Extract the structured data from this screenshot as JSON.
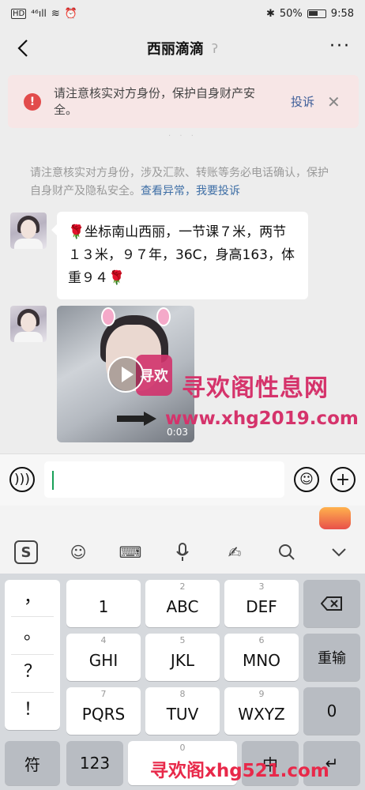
{
  "status_bar": {
    "signal": "⁴⁶ıll",
    "battery_percent": "50%",
    "time": "9:58"
  },
  "header": {
    "title": "西丽滴滴",
    "more": "···"
  },
  "warning": {
    "icon": "!",
    "text": "请注意核实对方身份，保护自身财产安全。",
    "report_label": "投诉",
    "close": "✕"
  },
  "notice": {
    "text": "请注意核实对方身份，涉及汇款、转账等务必电话确认，保护自身财产及隐私安全。",
    "link_view": "查看异常",
    "separator": "，",
    "link_report": "我要投诉"
  },
  "messages": [
    {
      "type": "text",
      "text": "🌹坐标南山西丽，一节课７米，两节１３米，９７年，36C，身高163，体重９４🌹"
    },
    {
      "type": "video",
      "duration": "0:03",
      "logo": "寻欢"
    }
  ],
  "watermarks": {
    "top": "寻欢阁性息网",
    "url": "www.xhg2019.com",
    "bottom": "寻欢阁xhg521.com"
  },
  "input_bar": {
    "value": ""
  },
  "keyboard": {
    "toolbar_icons": [
      "sogou-icon",
      "emoji-icon",
      "keyboard-icon",
      "microphone-icon",
      "handwriting-icon",
      "search-icon",
      "chevron-down-icon"
    ],
    "punctuation": [
      "，",
      "。",
      "？",
      "！"
    ],
    "keys_row1": [
      {
        "num": "",
        "label": "1"
      },
      {
        "num": "2",
        "label": "ABC"
      },
      {
        "num": "3",
        "label": "DEF"
      }
    ],
    "keys_row2": [
      {
        "num": "4",
        "label": "GHI"
      },
      {
        "num": "5",
        "label": "JKL"
      },
      {
        "num": "6",
        "label": "MNO"
      }
    ],
    "keys_row3": [
      {
        "num": "7",
        "label": "PQRS"
      },
      {
        "num": "8",
        "label": "TUV"
      },
      {
        "num": "9",
        "label": "WXYZ"
      }
    ],
    "reenter": "重输",
    "zero": "0",
    "symbols": "符",
    "numbers": "123",
    "space_sub": "0",
    "lang": "中",
    "enter": "↵"
  }
}
